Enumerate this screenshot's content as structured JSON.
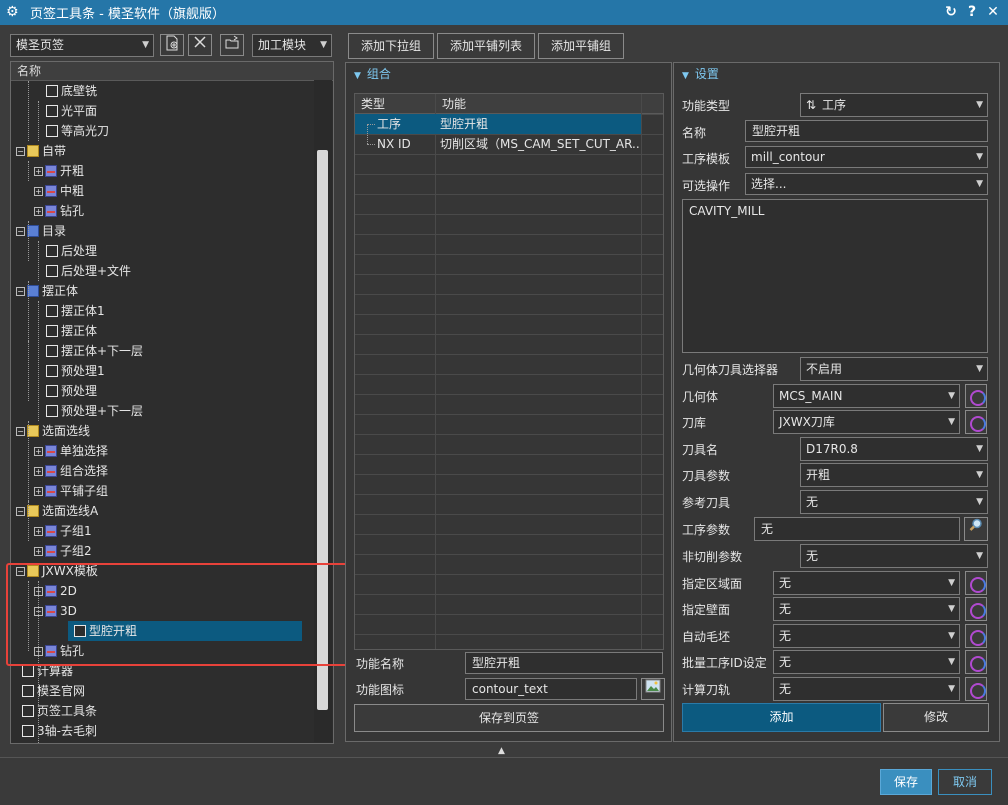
{
  "window": {
    "title": "页签工具条 - 模圣软件（旗舰版）",
    "refresh_glyph": "↻",
    "help_glyph": "?",
    "close_glyph": "✕"
  },
  "toolbar": {
    "page_select": "模圣页签",
    "module_select": "加工模块",
    "buttons": [
      "添加下拉组",
      "添加平铺列表",
      "添加平铺组"
    ]
  },
  "tree": {
    "header": "名称",
    "rows": [
      {
        "label": "底壁铣",
        "icon": "checkbox-icon"
      },
      {
        "label": "光平面",
        "icon": "checkbox-icon"
      },
      {
        "label": "等高光刀",
        "icon": "checkbox-icon"
      },
      {
        "label": "自带",
        "icon": "folder-icon"
      },
      {
        "label": "开粗",
        "icon": "tab-icon"
      },
      {
        "label": "中粗",
        "icon": "tab-icon"
      },
      {
        "label": "钻孔",
        "icon": "tab-icon"
      },
      {
        "label": "目录",
        "icon": "book-icon"
      },
      {
        "label": "后处理",
        "icon": "checkbox-icon"
      },
      {
        "label": "后处理+文件",
        "icon": "checkbox-icon"
      },
      {
        "label": "摆正体",
        "icon": "book-icon"
      },
      {
        "label": "摆正体1",
        "icon": "checkbox-icon"
      },
      {
        "label": "摆正体",
        "icon": "checkbox-icon"
      },
      {
        "label": "摆正体+下一层",
        "icon": "checkbox-icon"
      },
      {
        "label": "预处理1",
        "icon": "checkbox-icon"
      },
      {
        "label": "预处理",
        "icon": "checkbox-icon"
      },
      {
        "label": "预处理+下一层",
        "icon": "checkbox-icon"
      },
      {
        "label": "选面选线",
        "icon": "folder-icon"
      },
      {
        "label": "单独选择",
        "icon": "tab-icon"
      },
      {
        "label": "组合选择",
        "icon": "tab-icon"
      },
      {
        "label": "平铺子组",
        "icon": "tab-icon"
      },
      {
        "label": "选面选线A",
        "icon": "folder-icon"
      },
      {
        "label": "子组1",
        "icon": "tab-icon"
      },
      {
        "label": "子组2",
        "icon": "tab-icon"
      },
      {
        "label": "JXWX模板",
        "icon": "folder-icon"
      },
      {
        "label": "2D",
        "icon": "tab-icon"
      },
      {
        "label": "3D",
        "icon": "tab-icon"
      },
      {
        "label": "型腔开粗",
        "icon": "checkbox-icon"
      },
      {
        "label": "钻孔",
        "icon": "tab-icon"
      },
      {
        "label": "计算器",
        "icon": "checkbox-icon"
      },
      {
        "label": "模圣官网",
        "icon": "checkbox-icon"
      },
      {
        "label": "页签工具条",
        "icon": "checkbox-icon"
      },
      {
        "label": "3轴-去毛刺",
        "icon": "checkbox-icon"
      }
    ]
  },
  "group_panel": {
    "title": "组合",
    "columns": [
      "类型",
      "功能"
    ],
    "rows": [
      {
        "type": "工序",
        "func": "型腔开粗"
      },
      {
        "type": "NX ID",
        "func": "切削区域（MS_CAM_SET_CUT_AR..."
      }
    ],
    "func_name_label": "功能名称",
    "func_name_value": "型腔开粗",
    "func_icon_label": "功能图标",
    "func_icon_value": "contour_text",
    "save_button": "保存到页签"
  },
  "settings": {
    "title": "设置",
    "func_type_label": "功能类型",
    "func_type_value": "工序",
    "name_label": "名称",
    "name_value": "型腔开粗",
    "template_label": "工序模板",
    "template_value": "mill_contour",
    "optional_label": "可选操作",
    "optional_value": "选择...",
    "ops_text": "CAVITY_MILL",
    "geom_tool_label": "几何体刀具选择器",
    "geom_tool_value": "不启用",
    "geometry_label": "几何体",
    "geometry_value": "MCS_MAIN",
    "library_label": "刀库",
    "library_value": "JXWX刀库",
    "tool_name_label": "刀具名",
    "tool_name_value": "D17R0.8",
    "tool_param_label": "刀具参数",
    "tool_param_value": "开粗",
    "ref_tool_label": "参考刀具",
    "ref_tool_value": "无",
    "op_param_label": "工序参数",
    "op_param_value": "无",
    "noncut_label": "非切削参数",
    "noncut_value": "无",
    "region_label": "指定区域面",
    "region_value": "无",
    "wall_label": "指定壁面",
    "wall_value": "无",
    "blank_label": "自动毛坯",
    "blank_value": "无",
    "batch_label": "批量工序ID设定",
    "batch_value": "无",
    "path_label": "计算刀轨",
    "path_value": "无",
    "add_button": "添加",
    "modify_button": "修改"
  },
  "footer": {
    "save": "保存",
    "cancel": "取消"
  },
  "colors": {
    "titlebar": "#2576a8",
    "accent": "#3a8fbf",
    "selection": "#0c5a80",
    "highlight_box": "#e8423a"
  }
}
